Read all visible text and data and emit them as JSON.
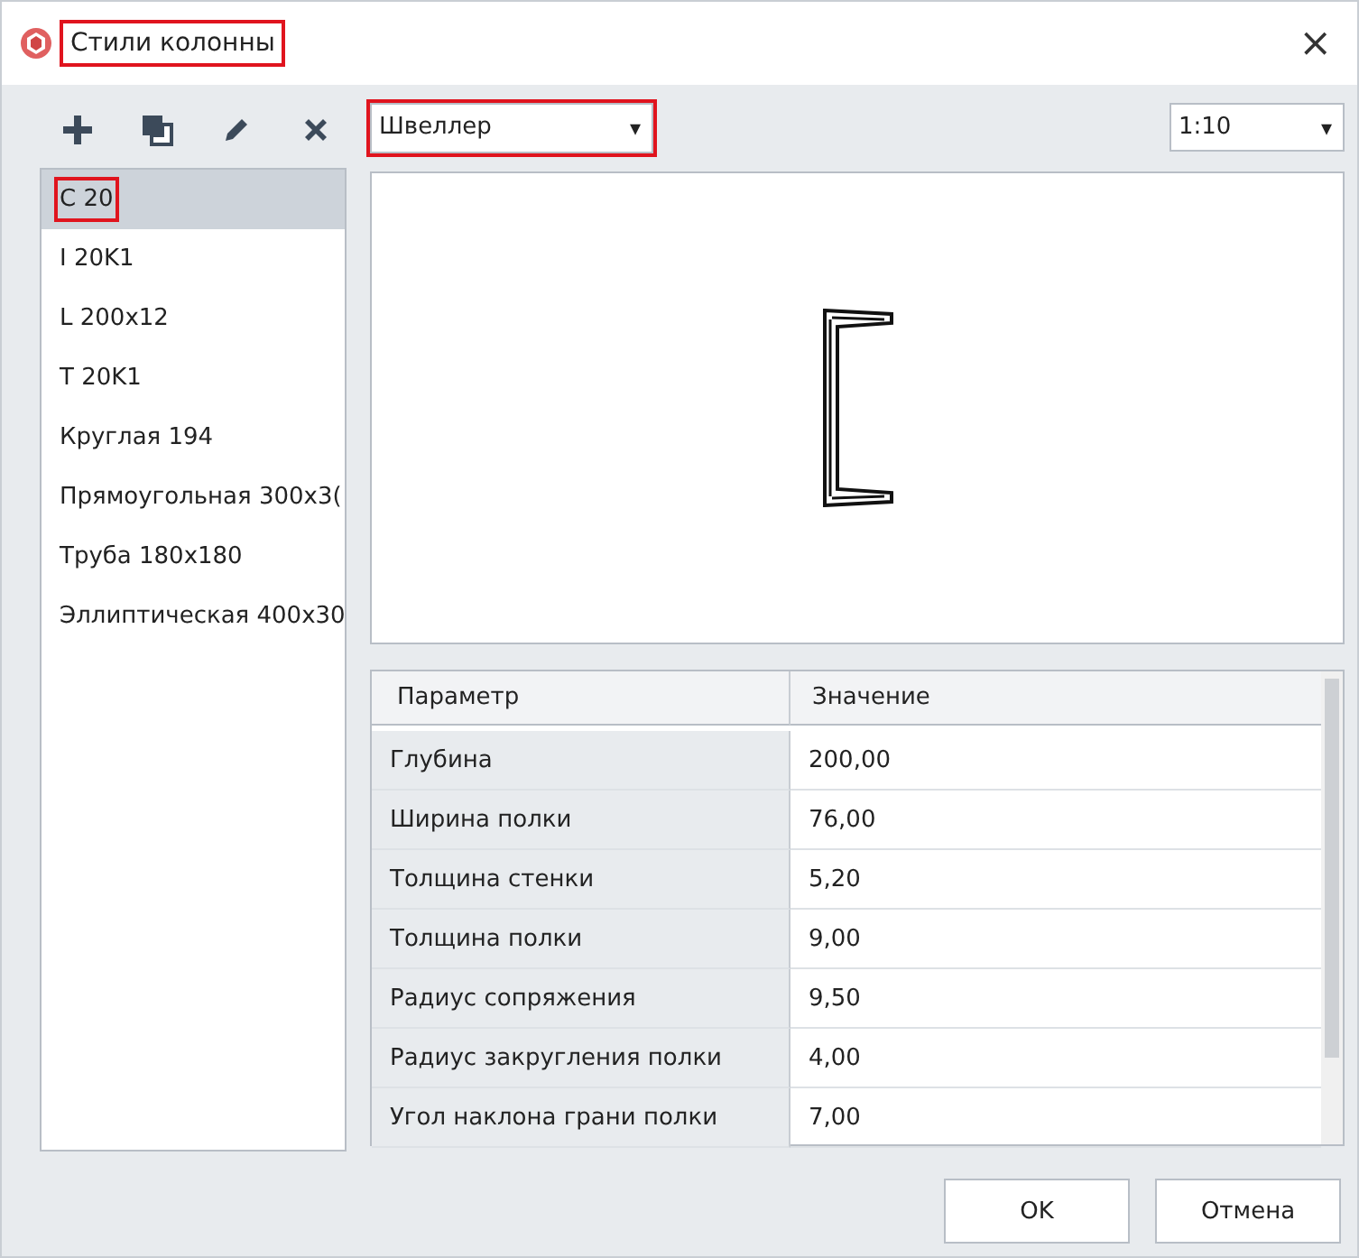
{
  "window": {
    "title": "Стили колонны",
    "title_highlighted": true,
    "close": "×"
  },
  "toolbar": [
    {
      "kind": "add"
    },
    {
      "kind": "copy"
    },
    {
      "kind": "edit"
    },
    {
      "kind": "delete"
    }
  ],
  "styles": [
    {
      "label": "C 20",
      "selected": true,
      "highlighted": true
    },
    {
      "label": "I 20K1",
      "selected": false,
      "highlighted": false
    },
    {
      "label": "L 200x12",
      "selected": false,
      "highlighted": false
    },
    {
      "label": "T 20K1",
      "selected": false,
      "highlighted": false
    },
    {
      "label": "Круглая 194",
      "selected": false,
      "highlighted": false
    },
    {
      "label": "Прямоугольная 300x3(",
      "selected": false,
      "highlighted": false
    },
    {
      "label": "Труба 180x180",
      "selected": false,
      "highlighted": false
    },
    {
      "label": "Эллиптическая 400x30",
      "selected": false,
      "highlighted": false
    }
  ],
  "profile_type": {
    "value": "Швеллер",
    "highlighted": true,
    "caret": "▾"
  },
  "scale": {
    "value": "1:10",
    "caret": "▾"
  },
  "preview": {
    "kind": "channel"
  },
  "table": {
    "columns": [
      "Параметр",
      "Значение"
    ],
    "rows": [
      [
        "Глубина",
        "200,00"
      ],
      [
        "Ширина полки",
        "76,00"
      ],
      [
        "Толщина стенки",
        "5,20"
      ],
      [
        "Толщина полки",
        "9,00"
      ],
      [
        "Радиус сопряжения",
        "9,50"
      ],
      [
        "Радиус закругления полки",
        "4,00"
      ],
      [
        "Угол наклона грани полки",
        "7,00"
      ]
    ]
  },
  "buttons": [
    "OK",
    "Отмена"
  ]
}
